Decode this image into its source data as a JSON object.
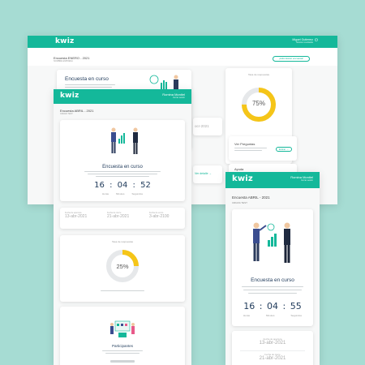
{
  "brand": {
    "logo": "kwiz",
    "accent": "#14b89a",
    "ring_color": "#f5c518",
    "background": "#a6dcd3"
  },
  "back_window": {
    "user_name": "Miguel Gutierrez",
    "user_sub": "Mostrar resultados",
    "survey_title": "Encuesta ENERO - 2021",
    "survey_sub": "NOMBRE EMPRESA",
    "action_button": "¡Administrar encuesta!",
    "status_title": "Encuesta en curso",
    "rate_title": "Tasa de respuestas",
    "rate_value": "75%",
    "rate_fraction": 0.75,
    "rate_caption": "Tus respuestas se actualizan a diario",
    "questions_label": "Ver Preguntas",
    "questions_button": "Entrar",
    "help_label": "Ayuda",
    "detail_link": "Ver detalle",
    "partial_date": "ocr-2021"
  },
  "middle_window": {
    "user_name": "Romina Montiel",
    "user_sub": "Cerrar sesión",
    "survey_title": "Encuesta ABRIL - 2021",
    "survey_sub": "CRIAVA TEST",
    "status_title": "Encuesta en curso",
    "timer": {
      "hours": "16",
      "minutes": "04",
      "seconds": "52",
      "l_hours": "Horas",
      "l_minutes": "Minutos",
      "l_seconds": "Segundos"
    },
    "dates": [
      {
        "label": "Fecha de apertura",
        "value": "13-abr-2021"
      },
      {
        "label": "Fecha de cierre",
        "value": "21-abr-2021"
      },
      {
        "label": "Fecha de envío",
        "value": "3-abr-2100"
      }
    ],
    "rate_title": "Tasa de respuestas",
    "rate_value": "25%",
    "rate_fraction": 0.25,
    "participants_title": "Participantes"
  },
  "front_window": {
    "user_name": "Romina Montiel",
    "user_sub": "Cerrar sesión",
    "survey_title": "Encuesta ABRIL - 2021",
    "survey_sub": "CRIAVA TEST",
    "status_title": "Encuesta en curso",
    "timer": {
      "hours": "16",
      "minutes": "04",
      "seconds": "55",
      "l_hours": "Horas",
      "l_minutes": "Minutos",
      "l_seconds": "Segundos"
    },
    "dates": [
      {
        "label": "Fecha de apertura",
        "value": "13-abr-2021"
      },
      {
        "label": "Fecha de cierre",
        "value": "21-abr-2021"
      }
    ]
  }
}
